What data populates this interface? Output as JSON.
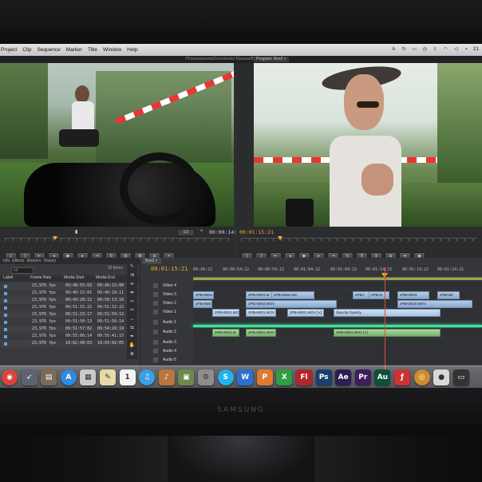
{
  "menubar": {
    "items": [
      "Project",
      "Clip",
      "Sequence",
      "Marker",
      "Title",
      "Window",
      "Help"
    ],
    "clock": "21"
  },
  "window": {
    "path": "/Пользователи/Documents/ Музыка/Box2.prproj",
    "program_tab": "Program: Box2 ×"
  },
  "source_monitor": {
    "timecode_right": "00:00:14:11",
    "zoom": "1/2"
  },
  "program_monitor": {
    "timecode_left": "00:01:15:21"
  },
  "project_panel": {
    "tabs": [
      "Info",
      "Effects",
      "Markers",
      "History"
    ],
    "items_count": "20 Items",
    "in_label": "All",
    "columns": [
      "Label",
      "Frame Rate",
      "Media Start",
      "Media End"
    ],
    "rows": [
      {
        "rate": "23,976 fps",
        "start": "09:48:55:03",
        "end": "09:49:15:00"
      },
      {
        "rate": "23,976 fps",
        "start": "09:49:15:01",
        "end": "09:49:28:11"
      },
      {
        "rate": "23,976 fps",
        "start": "09:49:28:12",
        "end": "09:50:13:16"
      },
      {
        "rate": "23,976 fps",
        "start": "09:51:15:22",
        "end": "09:51:32:22"
      },
      {
        "rate": "23,976 fps",
        "start": "09:51:33:17",
        "end": "09:51:50:12"
      },
      {
        "rate": "23,976 fps",
        "start": "09:51:50:13",
        "end": "09:51:56:14"
      },
      {
        "rate": "23,976 fps",
        "start": "09:51:57:02",
        "end": "09:54:26:19"
      },
      {
        "rate": "23,976 fps",
        "start": "09:55:06:14",
        "end": "09:55:41:15"
      },
      {
        "rate": "23,976 fps",
        "start": "10:02:48:03",
        "end": "10:03:02:05"
      }
    ]
  },
  "timeline": {
    "tab": "Box2 ×",
    "timecode": "00:01:15:21",
    "ruler": [
      "00:49:22",
      "00:00:54:22",
      "00:00:59:22",
      "00:01:04:22",
      "00:01:09:22",
      "00:01:14:22",
      "00:01:19:22",
      "00:01:24:21"
    ],
    "tracks": [
      "Video 4",
      "Video 3",
      "Video 2",
      "Video 1",
      "Audio 1",
      "Audio 2",
      "Audio 3",
      "Audio 4",
      "Audio 5"
    ],
    "clips": {
      "v3": [
        "2PBA9001.M",
        "2PBA9001.M",
        "2PBA9002.MC",
        "2PBA",
        "2PBA9",
        "2PBA9003",
        "2PBA90"
      ],
      "v2": [
        "2PBA9001.MOV",
        "2PBA9002.MOV",
        "2PBA9020.MOV"
      ],
      "v1": [
        "2PBA9001.MOV",
        "2PBA9001.MOV",
        "2PBA9001.MOV [V]",
        "Opacity:Opacity"
      ],
      "a1": [
        "2PBA9001.M",
        "2PBA9001.MOV",
        "2PBA9001.MOV [A]"
      ]
    }
  },
  "dock": {
    "icons": [
      {
        "name": "chrome",
        "glyph": "◉",
        "color": "#d9453b"
      },
      {
        "name": "rocket",
        "glyph": "➶",
        "color": "#5b6470"
      },
      {
        "name": "preview",
        "glyph": "▤",
        "color": "#7a6a58"
      },
      {
        "name": "app-store",
        "glyph": "A",
        "color": "#2f8be0"
      },
      {
        "name": "chart",
        "glyph": "▦",
        "color": "#c9c9c9"
      },
      {
        "name": "notes",
        "glyph": "✎",
        "color": "#e7d9a8"
      },
      {
        "name": "calendar",
        "glyph": "1",
        "color": "#f2f2f2"
      },
      {
        "name": "itunes",
        "glyph": "♫",
        "color": "#3aa0e8"
      },
      {
        "name": "guitar",
        "glyph": "♪",
        "color": "#b9773d"
      },
      {
        "name": "iphoto",
        "glyph": "▣",
        "color": "#6f8a4a"
      },
      {
        "name": "settings",
        "glyph": "⚙",
        "color": "#8d8d8d"
      },
      {
        "name": "skype",
        "glyph": "S",
        "color": "#1fb4ee"
      },
      {
        "name": "word",
        "glyph": "W",
        "color": "#2b6fd1"
      },
      {
        "name": "powerpoint",
        "glyph": "P",
        "color": "#e07a2e"
      },
      {
        "name": "excel",
        "glyph": "X",
        "color": "#2f9e43"
      },
      {
        "name": "flash",
        "glyph": "Fl",
        "color": "#b3262b"
      },
      {
        "name": "photoshop",
        "glyph": "Ps",
        "color": "#1a3f6e"
      },
      {
        "name": "after-effects",
        "glyph": "Ae",
        "color": "#2b1f52"
      },
      {
        "name": "premiere",
        "glyph": "Pr",
        "color": "#3d1d5c"
      },
      {
        "name": "audition",
        "glyph": "Au",
        "color": "#0f4f3a"
      },
      {
        "name": "flash-player",
        "glyph": "ƒ",
        "color": "#c33"
      },
      {
        "name": "dvd",
        "glyph": "◎",
        "color": "#d08a2c"
      },
      {
        "name": "camera",
        "glyph": "●",
        "color": "#d8d8d8"
      },
      {
        "name": "display",
        "glyph": "▭",
        "color": "#333"
      }
    ]
  },
  "brand": "SAMSUNG"
}
